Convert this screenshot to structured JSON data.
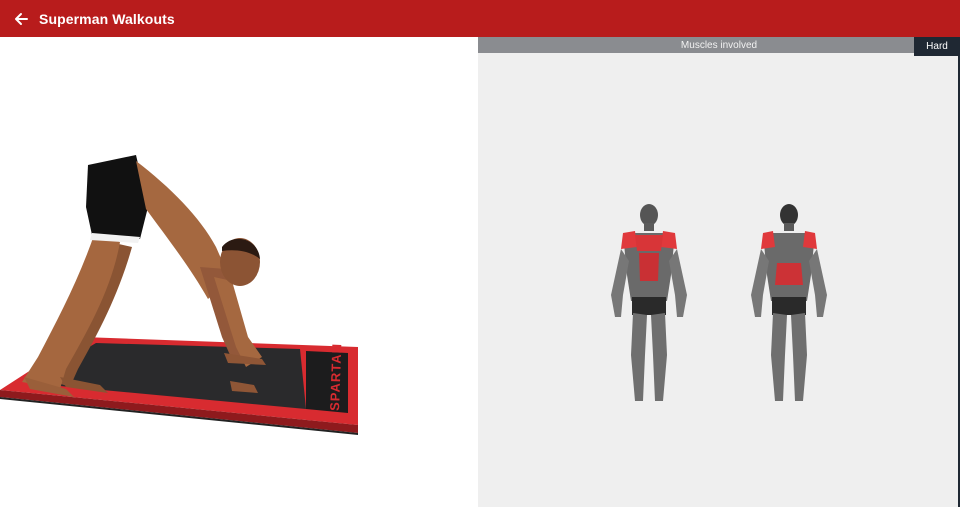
{
  "appbar": {
    "title": "Superman Walkouts",
    "back_icon": "arrow-left-icon",
    "color": "#b81c1c"
  },
  "exercise_animation": {
    "mat_brand": "SPARTAN",
    "mat_color": "#d82b30"
  },
  "muscles_panel": {
    "header": "Muscles involved",
    "difficulty": "Hard",
    "views": [
      "front",
      "back"
    ],
    "highlight_color": "#e0393c"
  }
}
